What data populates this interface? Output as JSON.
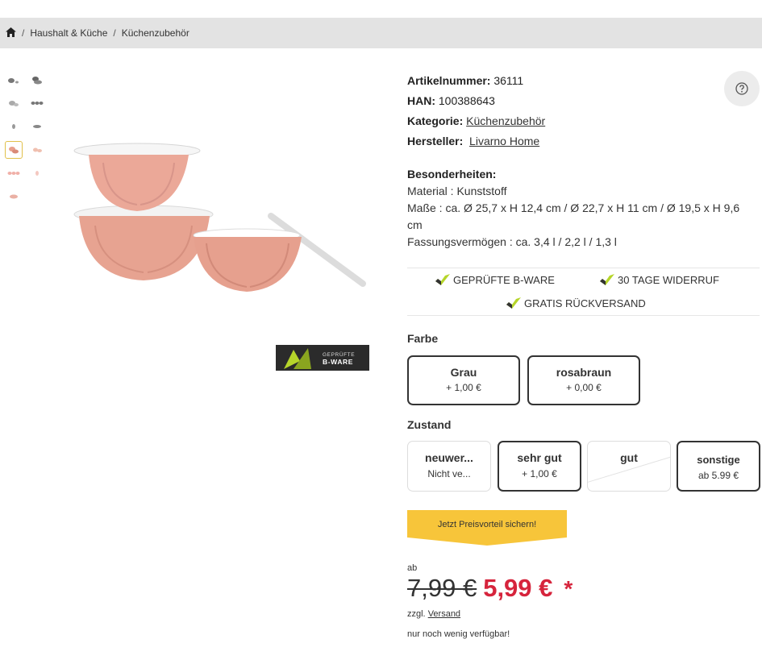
{
  "breadcrumb": {
    "items": [
      "Haushalt & Küche",
      "Küchenzubehör"
    ],
    "separator": "/"
  },
  "thumbnails": [
    {
      "name": "thumb-1"
    },
    {
      "name": "thumb-2"
    },
    {
      "name": "thumb-3"
    },
    {
      "name": "thumb-4"
    },
    {
      "name": "thumb-5"
    },
    {
      "name": "thumb-6"
    },
    {
      "name": "thumb-7"
    },
    {
      "name": "thumb-8"
    },
    {
      "name": "thumb-9"
    },
    {
      "name": "thumb-10"
    },
    {
      "name": "thumb-11"
    }
  ],
  "badge": {
    "line1": "GEPRÜFTE",
    "line2": "B-WARE"
  },
  "product": {
    "artikelnummer_label": "Artikelnummer:",
    "artikelnummer": "36111",
    "han_label": "HAN:",
    "han": "100388643",
    "kategorie_label": "Kategorie:",
    "kategorie": "Küchenzubehör",
    "hersteller_label": "Hersteller:",
    "hersteller": "Livarno Home"
  },
  "features": {
    "title": "Besonderheiten:",
    "material": "Material : Kunststoff",
    "masse": "Maße : ca. Ø 25,7 x H 12,4 cm / Ø 22,7 x H 11 cm / Ø 19,5 x H 9,6 cm",
    "volumen": "Fassungsvermögen : ca. 3,4 l / 2,2 l / 1,3 l"
  },
  "trust": {
    "item1": "GEPRÜFTE B-WARE",
    "item2": "30 TAGE WIDERRUF",
    "item3": "GRATIS RÜCKVERSAND"
  },
  "farbe": {
    "label": "Farbe",
    "options": [
      {
        "name": "Grau",
        "price": "+ 1,00 €"
      },
      {
        "name": "rosabraun",
        "price": "+ 0,00 €"
      }
    ]
  },
  "zustand": {
    "label": "Zustand",
    "options": [
      {
        "name": "neuwer...",
        "price": "Nicht ve..."
      },
      {
        "name": "sehr gut",
        "price": "+ 1,00 €"
      },
      {
        "name": "gut",
        "price": ""
      },
      {
        "name": "sonstige",
        "price": "ab 5.99 €"
      }
    ]
  },
  "cta": {
    "label": "Jetzt Preisvorteil sichern!"
  },
  "price": {
    "prefix": "ab",
    "old": "7,99 €",
    "new": "5,99 €",
    "star": "*",
    "shipping_prefix": "zzgl.",
    "shipping_link": "Versand",
    "stock": "nur noch wenig verfügbar!"
  },
  "colors": {
    "accent_yellow": "#f7c53a",
    "price_red": "#d6243c",
    "bowl_pink": "#e8a08c",
    "badge_green": "#b6d52a",
    "badge_dark": "#2b2b2b"
  }
}
